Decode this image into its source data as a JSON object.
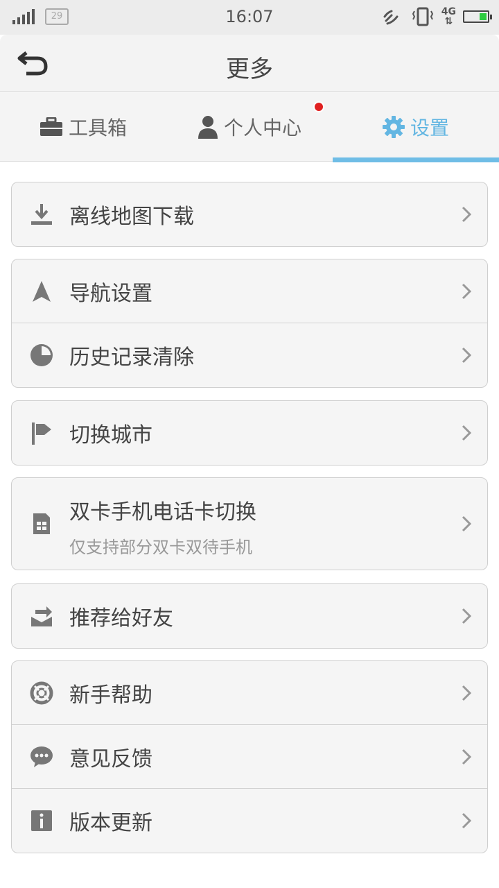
{
  "status_bar": {
    "time": "16:07",
    "badge": "29",
    "network": "4G"
  },
  "header": {
    "title": "更多"
  },
  "tabs": [
    {
      "label": "工具箱"
    },
    {
      "label": "个人中心"
    },
    {
      "label": "设置"
    }
  ],
  "groups": [
    {
      "items": [
        {
          "label": "离线地图下载",
          "icon": "download-icon"
        }
      ]
    },
    {
      "items": [
        {
          "label": "导航设置",
          "icon": "navigation-arrow-icon"
        },
        {
          "label": "历史记录清除",
          "icon": "pie-clock-icon"
        }
      ]
    },
    {
      "items": [
        {
          "label": "切换城市",
          "icon": "flag-icon"
        }
      ]
    },
    {
      "items": [
        {
          "label": "双卡手机电话卡切换",
          "sublabel": "仅支持部分双卡双待手机",
          "icon": "sim-card-icon"
        }
      ]
    },
    {
      "items": [
        {
          "label": "推荐给好友",
          "icon": "share-icon"
        }
      ]
    },
    {
      "items": [
        {
          "label": "新手帮助",
          "icon": "lifebuoy-icon"
        },
        {
          "label": "意见反馈",
          "icon": "chat-bubble-icon"
        },
        {
          "label": "版本更新",
          "icon": "info-icon"
        }
      ]
    }
  ],
  "colors": {
    "accent": "#6fbde6",
    "notification": "#e02020"
  }
}
